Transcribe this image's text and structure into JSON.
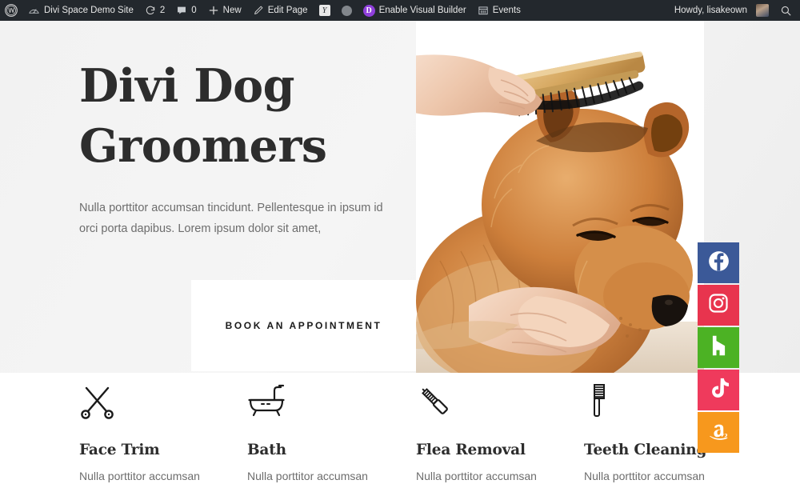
{
  "adminbar": {
    "wp_logo": "wordpress-logo-icon",
    "site_name": "Divi Space Demo Site",
    "updates_icon": "updates-icon",
    "updates_count": "2",
    "comments_icon": "comment-bubble-icon",
    "comments_count": "0",
    "new_icon": "plus-icon",
    "new_label": "New",
    "edit_icon": "pencil-icon",
    "edit_label": "Edit Page",
    "yoast_icon": "yoast-seo-icon",
    "status_dot": "gray-status-dot-icon",
    "divi_icon": "divi-logo-icon",
    "divi_label": "Enable Visual Builder",
    "events_icon": "calendar-icon",
    "events_label": "Events",
    "howdy": "Howdy, lisakeown",
    "avatar": "user-avatar",
    "search_icon": "search-icon"
  },
  "hero": {
    "title_line1": "Divi Dog",
    "title_line2": "Groomers",
    "description": "Nulla porttitor accumsan tincidunt. Pellentesque in ipsum id orci porta dapibus. Lorem ipsum dolor sit amet,",
    "cta_label": "BOOK AN APPOINTMENT",
    "photo_alt": "chow-chow-dog-being-brushed-photo"
  },
  "social": [
    {
      "name": "facebook",
      "label": "Facebook",
      "color": "#3b5998"
    },
    {
      "name": "instagram",
      "label": "Instagram",
      "color": "#e8344e"
    },
    {
      "name": "houzz",
      "label": "Houzz",
      "color": "#4cb224"
    },
    {
      "name": "tiktok",
      "label": "TikTok",
      "color": "#ef3a5c"
    },
    {
      "name": "amazon",
      "label": "Amazon",
      "color": "#f7981d"
    }
  ],
  "features": [
    {
      "icon": "scissors-icon",
      "title": "Face Trim",
      "desc": "Nulla porttitor accumsan"
    },
    {
      "icon": "bathtub-icon",
      "title": "Bath",
      "desc": "Nulla porttitor accumsan"
    },
    {
      "icon": "flea-comb-icon",
      "title": "Flea Removal",
      "desc": "Nulla porttitor accumsan"
    },
    {
      "icon": "toothbrush-icon",
      "title": "Teeth Cleaning",
      "desc": "Nulla porttitor accumsan"
    }
  ],
  "colors": {
    "adminbar_bg": "#23282d",
    "hero_bg": "#f2f2f2",
    "text_dark": "#2d2d2d",
    "text_muted": "#6d6d6d",
    "divi_purple": "#8f3fdb"
  }
}
